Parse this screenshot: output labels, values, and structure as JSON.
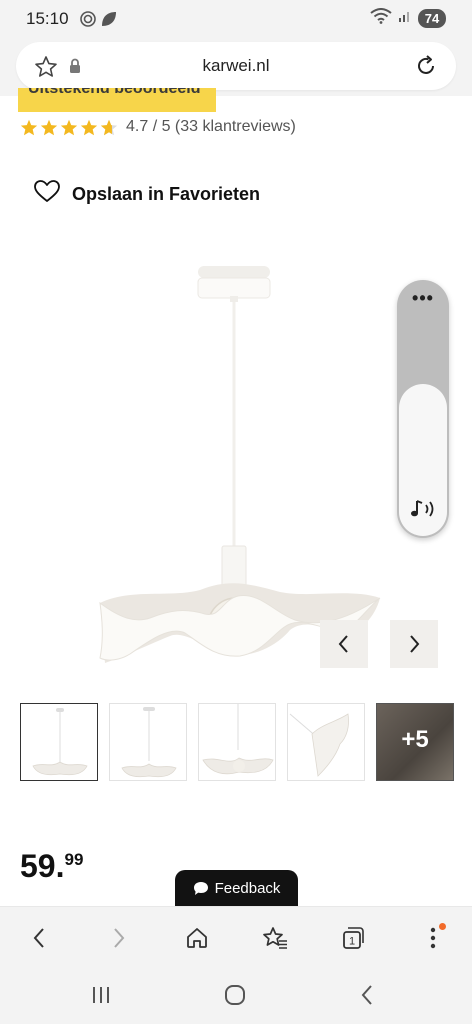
{
  "status_bar": {
    "time": "15:10",
    "battery": "74"
  },
  "browser": {
    "url": "karwei.nl"
  },
  "product": {
    "badge": "Uitstekend beoordeeld",
    "rating_value": 4.7,
    "rating_text": "4.7 / 5 (33 klantreviews)",
    "favorite_label": "Opslaan in Favorieten",
    "price_main": "59.",
    "price_cents": "99",
    "thumbnail_more_label": "+5"
  },
  "feedback": {
    "label": "Feedback"
  },
  "sound_widget": {
    "more_icon": "more-dots-icon",
    "level": 0.6
  },
  "colors": {
    "badge": "#f7d54a",
    "star": "#f3b81f",
    "accent_dot": "#f26b2a",
    "feedback_bg": "#121212"
  }
}
